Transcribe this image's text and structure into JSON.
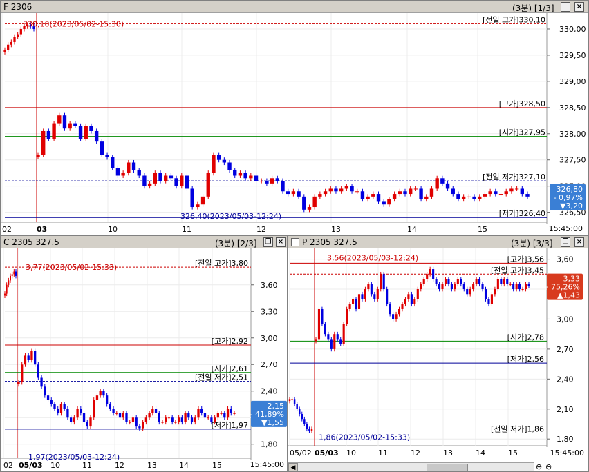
{
  "panels": {
    "top": {
      "title": "F 2306",
      "period": "(3분) [1/3]",
      "time_label": "15:45:00"
    },
    "left": {
      "title": "C 2305 327.5",
      "period": "(3분) [2/3]",
      "time_label": "15:45:00"
    },
    "right": {
      "title": "P 2305 327.5",
      "period": "(3분) [3/3]",
      "time_label": "15:45:00"
    }
  },
  "icons": [
    "restore-icon",
    "close-icon",
    "zoom-in-icon",
    "zoom-out-icon",
    "scroll-left-icon",
    "scroll-right-icon"
  ],
  "colors": {
    "up": "#e00000",
    "down": "#0000e0",
    "high_line": "#cc0000",
    "open_line": "#008800",
    "low_line": "#000099",
    "badge_down": "#3a7fd5",
    "badge_up": "#d83a1e"
  },
  "chart_data": [
    {
      "type": "candlestick",
      "name": "F 2306",
      "ylim": [
        326.35,
        330.25
      ],
      "yticks": [
        "330,00",
        "329,50",
        "329,00",
        "328,50",
        "328,00",
        "327,50",
        "327,00",
        "326,50"
      ],
      "yticks_values": [
        330.0,
        329.5,
        329.0,
        328.5,
        328.0,
        327.5,
        327.0,
        326.5
      ],
      "xticks": [
        "02",
        "03",
        "10",
        "11",
        "12",
        "13",
        "14",
        "15"
      ],
      "price_lines": [
        {
          "label": "[전일 고가]330,10",
          "value": 330.1,
          "style": "dashed",
          "color": "#cc0000"
        },
        {
          "label": "[고가]328,50",
          "value": 328.5,
          "style": "solid",
          "color": "#cc0000"
        },
        {
          "label": "[시가]327,95",
          "value": 327.95,
          "style": "solid",
          "color": "#008800"
        },
        {
          "label": "[전일 저가]327,10",
          "value": 327.1,
          "style": "dashed",
          "color": "#000099"
        },
        {
          "label": "[저가]326,40",
          "value": 326.4,
          "style": "solid",
          "color": "#000099"
        }
      ],
      "annotations": [
        {
          "text": "330,10(2023/05/02-15:30)",
          "color": "#cc0000"
        },
        {
          "text": "326,40(2023/05/03-12:24)",
          "color": "#000099"
        }
      ],
      "current_badge": {
        "lines": [
          "326,80",
          "- 0,97%",
          "▼3,20"
        ],
        "direction": "down"
      },
      "prev_day": [
        329.6,
        329.7,
        329.75,
        329.85,
        329.9,
        330.0,
        330.05,
        330.08,
        330.05,
        330.0
      ],
      "today": [
        327.6,
        328.05,
        327.9,
        328.2,
        328.35,
        328.1,
        328.2,
        328.15,
        327.9,
        328.15,
        328.05,
        327.85,
        327.6,
        327.55,
        327.35,
        327.2,
        327.25,
        327.45,
        327.3,
        327.2,
        327.0,
        327.05,
        327.25,
        327.1,
        327.2,
        327.15,
        327.0,
        327.2,
        326.95,
        326.6,
        326.65,
        326.8,
        327.25,
        327.6,
        327.5,
        327.45,
        327.3,
        327.2,
        327.25,
        327.15,
        327.2,
        327.1,
        327.1,
        327.05,
        327.15,
        327.1,
        326.9,
        326.85,
        326.9,
        326.8,
        326.55,
        326.6,
        326.8,
        326.85,
        326.9,
        326.95,
        326.9,
        326.95,
        327.0,
        326.9,
        326.9,
        326.75,
        326.8,
        326.85,
        326.7,
        326.65,
        326.75,
        326.85,
        326.9,
        326.85,
        326.95,
        326.95,
        326.75,
        326.8,
        326.95,
        327.15,
        327.05,
        326.95,
        326.85,
        326.75,
        326.8,
        326.8,
        326.75,
        326.8,
        326.85,
        326.9,
        326.85,
        326.85,
        326.9,
        326.95,
        326.95,
        326.85,
        326.8
      ]
    },
    {
      "type": "candlestick",
      "name": "C 2305 327.5",
      "ylim": [
        1.72,
        3.98
      ],
      "yticks": [
        "3,60",
        "3,30",
        "3,00",
        "2,70",
        "2,40",
        "2,10",
        "1,80"
      ],
      "yticks_values": [
        3.6,
        3.3,
        3.0,
        2.7,
        2.4,
        2.1,
        1.8
      ],
      "xticks": [
        "02",
        "05/03",
        "10",
        "11",
        "12",
        "13",
        "14",
        "15"
      ],
      "price_lines": [
        {
          "label": "[전일 고가]3,80",
          "value": 3.8,
          "style": "dashed",
          "color": "#cc0000"
        },
        {
          "label": "[고가]2,92",
          "value": 2.92,
          "style": "solid",
          "color": "#cc0000"
        },
        {
          "label": "[시가]2,61",
          "value": 2.61,
          "style": "solid",
          "color": "#008800"
        },
        {
          "label": "[전일 저가]2,51",
          "value": 2.51,
          "style": "dashed",
          "color": "#000099"
        },
        {
          "label": "[저가]1,97",
          "value": 1.97,
          "style": "solid",
          "color": "#000099"
        }
      ],
      "annotations": [
        {
          "text": "3,77(2023/05/02-15:33)",
          "color": "#cc0000"
        },
        {
          "text": "1,97(2023/05/03-12:24)",
          "color": "#000099"
        }
      ],
      "current_badge": {
        "lines": [
          "2,15",
          "- 41,89%",
          "▼1,55"
        ],
        "direction": "down"
      },
      "prev_day": [
        3.5,
        3.6,
        3.65,
        3.7,
        3.72,
        3.75,
        3.7
      ],
      "today": [
        2.5,
        2.7,
        2.8,
        2.75,
        2.85,
        2.7,
        2.55,
        2.45,
        2.35,
        2.3,
        2.25,
        2.2,
        2.15,
        2.25,
        2.2,
        2.1,
        2.05,
        2.1,
        2.2,
        2.15,
        2.05,
        2.0,
        2.1,
        2.3,
        2.35,
        2.4,
        2.35,
        2.25,
        2.2,
        2.15,
        2.15,
        2.1,
        2.15,
        2.05,
        2.05,
        2.1,
        2.0,
        1.98,
        2.05,
        2.1,
        2.15,
        2.2,
        2.15,
        2.05,
        2.05,
        2.1,
        2.1,
        2.05,
        2.05,
        2.1,
        2.05,
        2.15,
        2.1,
        2.05,
        2.1,
        2.2,
        2.15,
        2.1,
        2.1,
        2.05,
        2.1,
        2.15,
        2.15,
        2.1,
        2.2,
        2.15,
        2.15
      ]
    },
    {
      "type": "candlestick",
      "name": "P 2305 327.5",
      "ylim": [
        1.76,
        3.68
      ],
      "yticks": [
        "3,60",
        "3,30",
        "3,00",
        "2,70",
        "2,40",
        "2,10",
        "1,80"
      ],
      "yticks_values": [
        3.6,
        3.3,
        3.0,
        2.7,
        2.4,
        2.1,
        1.8
      ],
      "xticks": [
        "05/02",
        "05/03",
        "10",
        "11",
        "12",
        "13",
        "14",
        "15"
      ],
      "price_lines": [
        {
          "label": "[고가]3,56",
          "value": 3.56,
          "style": "solid",
          "color": "#cc0000"
        },
        {
          "label": "[전일 고가]3,45",
          "value": 3.45,
          "style": "dashed",
          "color": "#cc0000"
        },
        {
          "label": "[시가]2,78",
          "value": 2.78,
          "style": "solid",
          "color": "#008800"
        },
        {
          "label": "[저가]2,56",
          "value": 2.56,
          "style": "solid",
          "color": "#000099"
        },
        {
          "label": "[전일 저가]1,86",
          "value": 1.86,
          "style": "dashed",
          "color": "#000099"
        }
      ],
      "annotations": [
        {
          "text": "3,56(2023/05/03-12:24)",
          "color": "#cc0000"
        },
        {
          "text": "1,86(2023/05/02-15:33)",
          "color": "#000099"
        }
      ],
      "current_badge": {
        "lines": [
          "3,33",
          "+ 75,26%",
          "▲1,43"
        ],
        "direction": "up"
      },
      "prev_day": [
        2.2,
        2.2,
        2.15,
        2.1,
        2.05,
        2.0,
        1.95,
        1.9,
        1.88,
        1.9
      ],
      "today": [
        2.8,
        3.1,
        2.95,
        2.85,
        2.8,
        2.7,
        2.85,
        2.8,
        2.75,
        2.95,
        3.1,
        3.15,
        3.2,
        3.1,
        3.25,
        3.2,
        3.3,
        3.35,
        3.25,
        3.2,
        3.3,
        3.45,
        3.3,
        3.15,
        3.05,
        3.0,
        3.05,
        3.1,
        3.15,
        3.2,
        3.25,
        3.15,
        3.2,
        3.3,
        3.35,
        3.4,
        3.45,
        3.5,
        3.4,
        3.35,
        3.3,
        3.35,
        3.4,
        3.35,
        3.3,
        3.35,
        3.4,
        3.35,
        3.3,
        3.25,
        3.3,
        3.35,
        3.4,
        3.35,
        3.3,
        3.2,
        3.15,
        3.25,
        3.3,
        3.4,
        3.35,
        3.4,
        3.35,
        3.35,
        3.3,
        3.35,
        3.3,
        3.3,
        3.35,
        3.33
      ]
    }
  ]
}
